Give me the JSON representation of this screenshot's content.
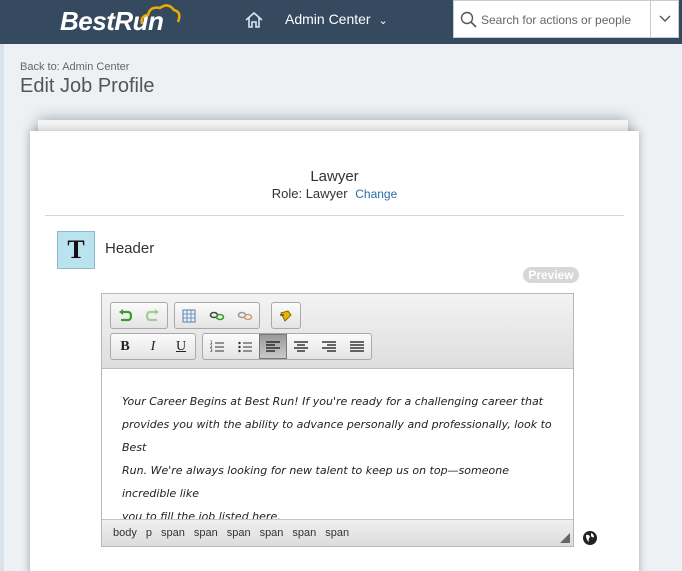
{
  "shell": {
    "logo": "BestRun",
    "menu_label": "Admin Center",
    "search_placeholder": "Search for actions or people"
  },
  "page": {
    "back_link": "Back to: Admin Center",
    "title": "Edit Job Profile"
  },
  "profile": {
    "job_title": "Lawyer",
    "role_prefix": "Role:",
    "role_value": "Lawyer",
    "change_label": "Change"
  },
  "section": {
    "icon_letter": "T",
    "label": "Header",
    "preview_label": "Preview"
  },
  "editor": {
    "lines": [
      "Your Career Begins at Best Run!  If you're ready for a challenging career that",
      "provides you with the ability to advance personally and professionally, look to Best",
      "Run.  We're always looking for new talent to keep us on top—someone incredible like",
      "you to fill the job listed here."
    ],
    "path": [
      "body",
      "p",
      "span",
      "span",
      "span",
      "span",
      "span",
      "span"
    ],
    "bold": "B",
    "italic": "I",
    "underline": "U"
  },
  "colors": {
    "shell": "#354a5f",
    "link": "#2a6da9",
    "header_icon_bg": "#b8e3ef"
  }
}
